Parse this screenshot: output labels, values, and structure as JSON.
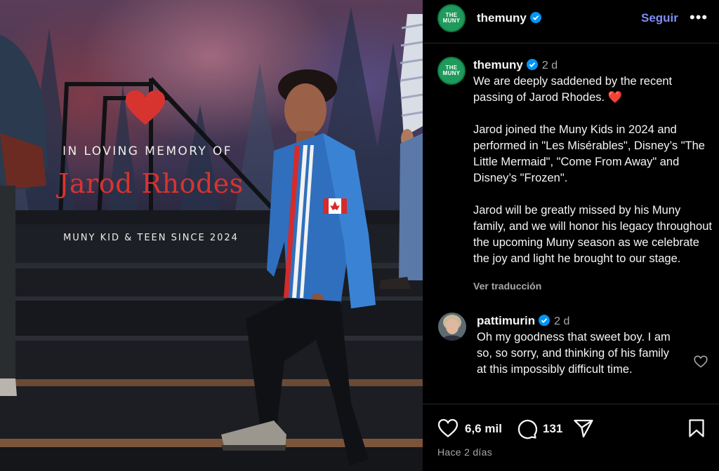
{
  "post_image": {
    "memory_heading": "IN LOVING MEMORY OF",
    "memory_name": "Jarod Rhodes",
    "memory_subline": "MUNY KID & TEEN SINCE 2024"
  },
  "header": {
    "avatar_text_line1": "THE",
    "avatar_text_line2": "MUNY",
    "username": "themuny",
    "follow_label": "Seguir",
    "more_label": "•••"
  },
  "caption": {
    "username": "themuny",
    "time": "2 d",
    "text": "We are deeply saddened by the recent passing of Jarod Rhodes. ❤️\n\nJarod joined the Muny Kids in 2024 and performed in \"Les Misérables\", Disney’s \"The Little Mermaid\", \"Come From Away\" and Disney’s \"Frozen\".\n\nJarod will be greatly missed by his Muny family, and we will honor his legacy throughout the upcoming Muny season as we celebrate the joy and light he brought to our stage.",
    "translate_label": "Ver traducción"
  },
  "comment": {
    "username": "pattimurin",
    "time": "2 d",
    "text": "Oh my goodness that sweet boy. I am so, so sorry, and thinking of his family at this impossibly difficult time."
  },
  "actions": {
    "likes": "6,6 mil",
    "comments": "131",
    "date": "Hace 2 días"
  },
  "colors": {
    "verified": "#0095f6",
    "follow": "#7e8cf6",
    "heart": "#d8342f",
    "brand_green": "#1f9a5b"
  }
}
